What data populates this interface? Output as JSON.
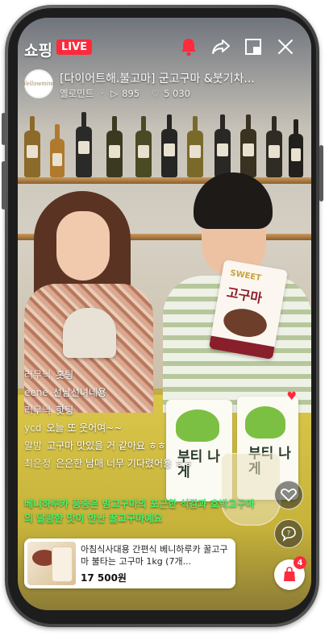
{
  "header": {
    "brand": "쇼핑",
    "live_badge": "LIVE",
    "icons": [
      "bell-icon",
      "share-icon",
      "pip-icon",
      "close-icon"
    ]
  },
  "channel": {
    "avatar_text": "Yellowmint",
    "title": "[다이어트해.불고마] 군고구마 &붓기차...",
    "name": "옐로민트",
    "views": "895",
    "likes": "5 030"
  },
  "chat": [
    {
      "user": "러무닉",
      "text": "홋팅"
    },
    {
      "user": "eene",
      "text": "선남선녀네용"
    },
    {
      "user": "러무닉",
      "text": "핫팅"
    },
    {
      "user": "ycd",
      "text": "오늘 또 웃어여~~"
    },
    {
      "user": "알밤",
      "text": "고구마 맛있을 거 같아요 ㅎㅎ"
    },
    {
      "user": "최은정",
      "text": "은은한 남매 너무 기다렸어용 ㅎㅎ"
    }
  ],
  "notice": "베니하루카 품종은 밤고구마의 포근한 식감과 호박고구마의 달콤한 맛이 만난 꿀고구마예요",
  "product": {
    "name": "아침식사대용 간편식 베니하루카 꿀고구마 불타는 고구마 1kg (7개...",
    "price": "17 500원"
  },
  "cart": {
    "count": "4"
  },
  "scene": {
    "pouch_brand": "SWEET",
    "pouch_title": "고구마",
    "box_title": "부티 나게"
  },
  "colors": {
    "live_red": "#ff2a3d",
    "notice_green": "#4af26b"
  }
}
